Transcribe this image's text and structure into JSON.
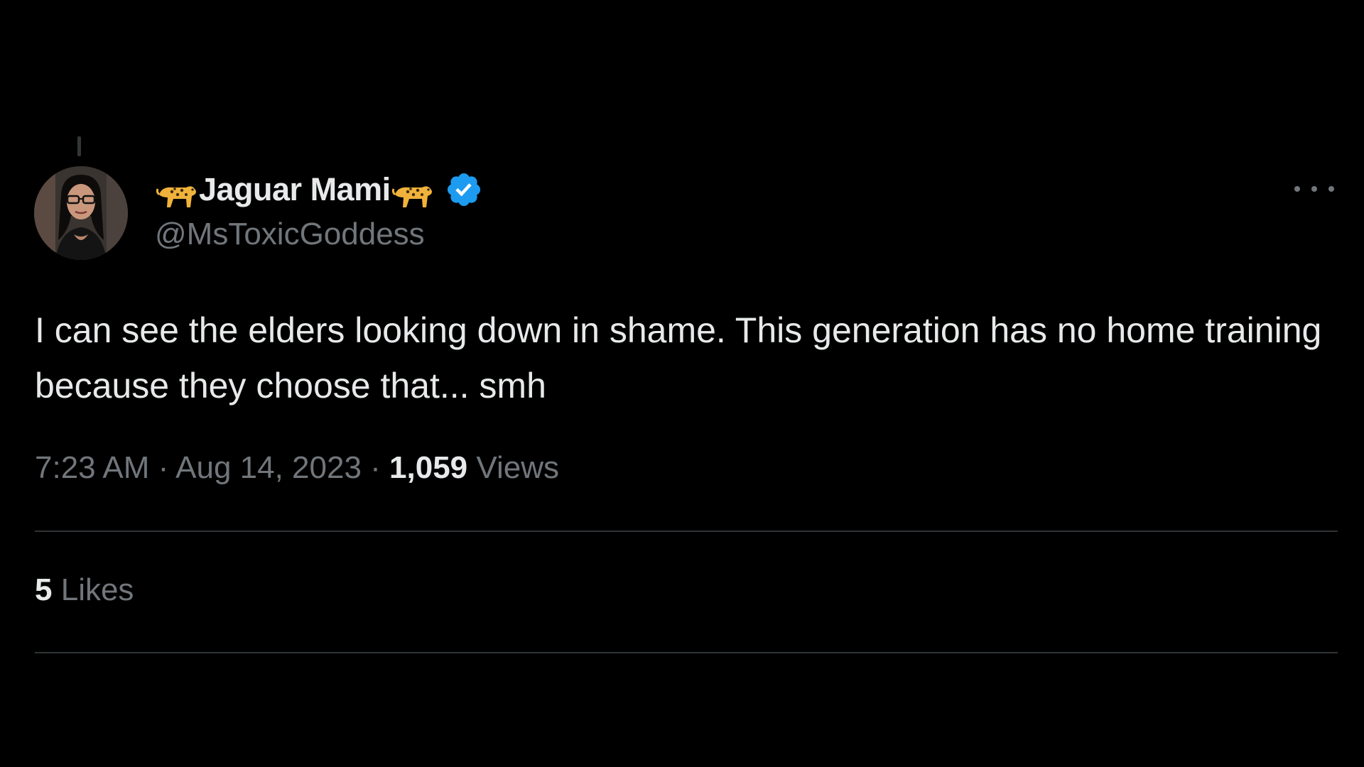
{
  "tweet": {
    "author": {
      "display_name": "Jaguar Mami",
      "handle": "@MsToxicGoddess",
      "verified": true,
      "emoji": "leopard-emoji"
    },
    "text": "I can see the elders looking down in shame. This generation has no home training because they choose that... smh",
    "time": "7:23 AM",
    "date": "Aug 14, 2023",
    "separator": "·",
    "views_count": "1,059",
    "views_label": "Views",
    "likes_count": "5",
    "likes_label": "Likes"
  },
  "colors": {
    "background": "#000000",
    "primary_text": "#e7e9ea",
    "secondary_text": "#71767b",
    "divider": "#2f3336",
    "verified_badge": "#1d9bf0"
  },
  "icons": {
    "more": "more-options-icon",
    "verified": "verified-badge-icon"
  }
}
